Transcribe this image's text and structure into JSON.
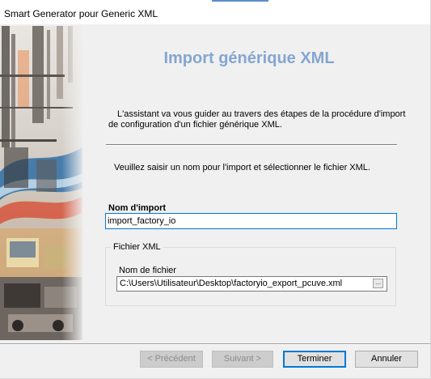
{
  "window": {
    "title": "Smart Generator pour Generic XML"
  },
  "wizard": {
    "heading": "Import générique XML",
    "intro_line1": "L'assistant va vous guider au travers des étapes de la procédure d'import",
    "intro_line2": "de configuration d'un fichier générique XML.",
    "instruction": "Veuillez saisir un nom pour l'import et sélectionner le fichier XML."
  },
  "form": {
    "name_label": "Nom d'import",
    "name_value": "import_factory_io",
    "group_label": "Fichier XML",
    "file_label": "Nom de fichier",
    "file_value": "C:\\Users\\Utilisateur\\Desktop\\factoryio_export_pcuve.xml",
    "browse_label": "..."
  },
  "buttons": {
    "previous": "< Précédent",
    "next": "Suivant >",
    "finish": "Terminer",
    "cancel": "Annuler"
  },
  "colors": {
    "heading": "#84a6cf",
    "accent_focus": "#0078d7"
  }
}
